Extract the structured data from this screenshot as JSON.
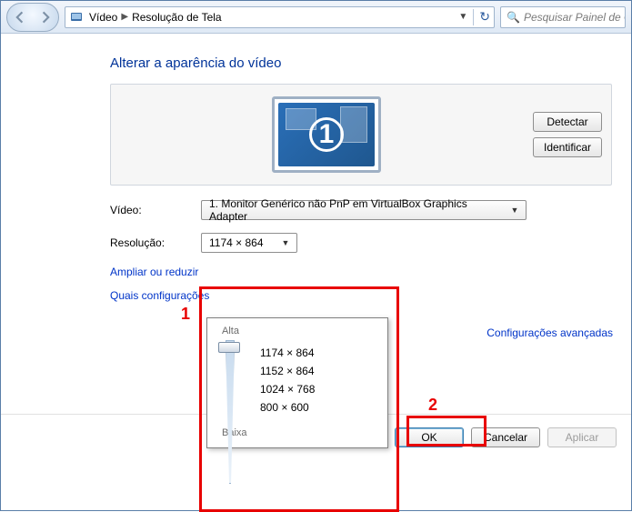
{
  "toolbar": {
    "breadcrumb": [
      "Vídeo",
      "Resolução de Tela"
    ],
    "search_placeholder": "Pesquisar Painel de Controle"
  },
  "page": {
    "title": "Alterar a aparência do vídeo",
    "monitor_number": "1",
    "detect_label": "Detectar",
    "identify_label": "Identificar"
  },
  "form": {
    "video_label": "Vídeo:",
    "video_value": "1. Monitor Genérico não PnP em VirtualBox Graphics Adapter",
    "resolution_label": "Resolução:",
    "resolution_value": "1174 × 864"
  },
  "dropdown": {
    "top_label": "Alta",
    "bottom_label": "Baixa",
    "options": [
      "1174 × 864",
      "1152 × 864",
      "1024 × 768",
      "800 × 600"
    ]
  },
  "links": {
    "advanced": "Configurações avançadas",
    "zoom": "Ampliar ou reduzir",
    "which": "Quais configurações"
  },
  "buttons": {
    "ok": "OK",
    "cancel": "Cancelar",
    "apply": "Aplicar"
  },
  "callouts": {
    "one": "1",
    "two": "2"
  }
}
